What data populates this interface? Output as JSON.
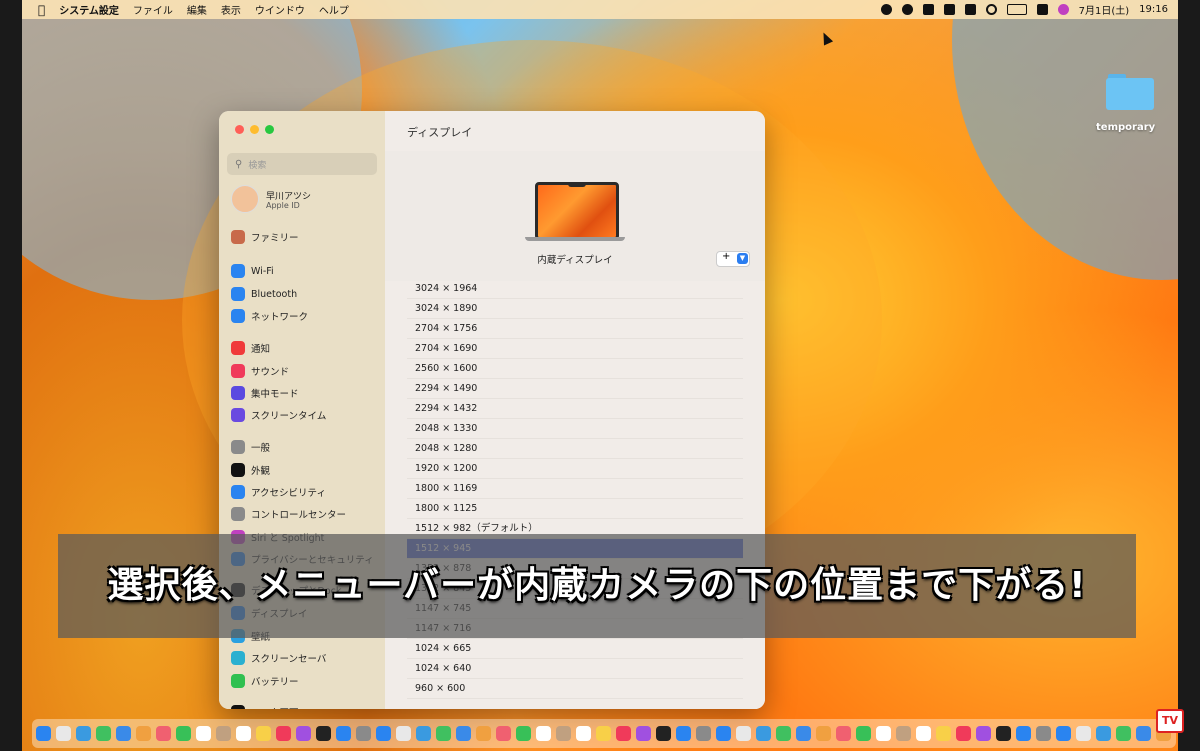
{
  "menubar": {
    "app_name": "システム設定",
    "menus": [
      "ファイル",
      "編集",
      "表示",
      "ウインドウ",
      "ヘルプ"
    ],
    "date": "7月1日(土)",
    "time": "19:16"
  },
  "desktop": {
    "folder_label": "temporary"
  },
  "window": {
    "search_placeholder": "検索",
    "user": {
      "name": "早川アツシ",
      "subtitle": "Apple ID"
    },
    "sidebar_items": [
      {
        "label": "ファミリー",
        "icon": "family-icon",
        "color": "#c86a4a"
      },
      {
        "label": "Wi-Fi",
        "icon": "wifi-icon",
        "color": "#2a84f0"
      },
      {
        "label": "Bluetooth",
        "icon": "bluetooth-icon",
        "color": "#2a84f0"
      },
      {
        "label": "ネットワーク",
        "icon": "globe-icon",
        "color": "#2a84f0"
      },
      {
        "label": "通知",
        "icon": "bell-icon",
        "color": "#f03a3a"
      },
      {
        "label": "サウンド",
        "icon": "speaker-icon",
        "color": "#f03a5a"
      },
      {
        "label": "集中モード",
        "icon": "moon-icon",
        "color": "#5a4ae0"
      },
      {
        "label": "スクリーンタイム",
        "icon": "hourglass-icon",
        "color": "#6a4ae0"
      },
      {
        "label": "一般",
        "icon": "gear-icon",
        "color": "#8a8a8a"
      },
      {
        "label": "外観",
        "icon": "appearance-icon",
        "color": "#111111"
      },
      {
        "label": "アクセシビリティ",
        "icon": "accessibility-icon",
        "color": "#2a84f0"
      },
      {
        "label": "コントロールセンター",
        "icon": "control-center-icon",
        "color": "#8a8a8a"
      },
      {
        "label": "Siri と Spotlight",
        "icon": "siri-icon",
        "color": "#c040c0"
      },
      {
        "label": "プライバシーとセキュリティ",
        "icon": "hand-icon",
        "color": "#2a84f0"
      },
      {
        "label": "デスクトップとDock",
        "icon": "desktop-icon",
        "color": "#111111"
      },
      {
        "label": "ディスプレイ",
        "icon": "display-icon",
        "color": "#2a84f0"
      },
      {
        "label": "壁紙",
        "icon": "wallpaper-icon",
        "color": "#2aa0e0"
      },
      {
        "label": "スクリーンセーバ",
        "icon": "screensaver-icon",
        "color": "#2ab0d0"
      },
      {
        "label": "バッテリー",
        "icon": "battery-icon",
        "color": "#30c050"
      },
      {
        "label": "ロック画面",
        "icon": "lock-icon",
        "color": "#111111"
      }
    ],
    "content_title": "ディスプレイ",
    "display_name": "内蔵ディスプレイ",
    "add_button": "+",
    "resolutions": [
      "3024 × 1964",
      "3024 × 1890",
      "2704 × 1756",
      "2704 × 1690",
      "2560 × 1600",
      "2294 × 1490",
      "2294 × 1432",
      "2048 × 1330",
      "2048 × 1280",
      "1920 × 1200",
      "1800 × 1169",
      "1800 × 1125",
      "1512 × 982（デフォルト）",
      "1512 × 945",
      "1352 × 878",
      "1352 × 845",
      "1147 × 745",
      "1147 × 716",
      "1024 × 665",
      "1024 × 640",
      "960 × 600"
    ],
    "selected_resolution": "1512 × 945"
  },
  "banner": {
    "text": "選択後、メニューバーが内蔵カメラの下の位置まで下がる!"
  },
  "watermark": "TV",
  "colors": {
    "selection": "#5b6fd8",
    "accent": "#2a7df0",
    "close": "#ff5f57",
    "minimize": "#febc2e",
    "zoom": "#28c840"
  },
  "dock_icons": [
    "finder-icon",
    "launchpad-icon",
    "safari-icon",
    "messages-icon",
    "mail-icon",
    "maps-icon",
    "photos-icon",
    "facetime-icon",
    "calendar-icon",
    "contacts-icon",
    "reminders-icon",
    "notes-icon",
    "music-icon",
    "podcasts-icon",
    "tv-icon",
    "appstore-icon",
    "settings-icon",
    "app-icon",
    "app-icon",
    "app-icon",
    "app-icon",
    "app-icon",
    "app-icon",
    "app-icon",
    "app-icon",
    "app-icon",
    "app-icon",
    "app-icon",
    "app-icon",
    "app-icon",
    "app-icon",
    "app-icon",
    "app-icon",
    "app-icon",
    "app-icon",
    "app-icon",
    "app-icon",
    "app-icon",
    "app-icon",
    "app-icon",
    "app-icon",
    "app-icon",
    "app-icon",
    "app-icon",
    "app-icon",
    "app-icon",
    "app-icon",
    "app-icon",
    "app-icon",
    "app-icon",
    "app-icon",
    "app-icon",
    "app-icon",
    "app-icon",
    "app-icon",
    "app-icon",
    "trash-icon"
  ]
}
